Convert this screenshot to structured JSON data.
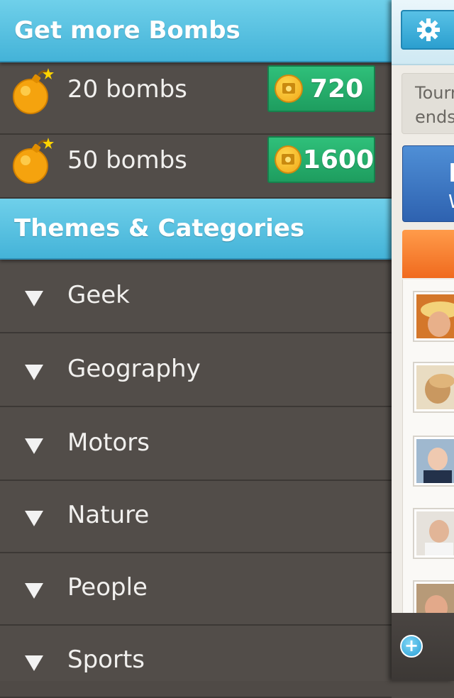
{
  "bombs_section": {
    "title": "Get more Bombs",
    "packs": [
      {
        "label": "20 bombs",
        "price": "720"
      },
      {
        "label": "50 bombs",
        "price": "1600"
      }
    ]
  },
  "themes_section": {
    "title": "Themes & Categories",
    "categories": [
      "Geek",
      "Geography",
      "Motors",
      "Nature",
      "People",
      "Sports"
    ]
  },
  "main_panel": {
    "tournament_text_line1": "Tourn",
    "tournament_text_line2": "ends",
    "card_big": "P",
    "card_small": "W"
  },
  "colors": {
    "header_blue": "#44b3d8",
    "price_green": "#1e9d5f",
    "drawer_bg": "#524d49",
    "coin_gold": "#f0a818",
    "orange": "#f06a1e"
  },
  "icons": {
    "bomb": "bomb-icon",
    "coin": "coin-icon",
    "gear": "gear-icon",
    "expand": "triangle-down-icon",
    "add": "plus-icon"
  }
}
